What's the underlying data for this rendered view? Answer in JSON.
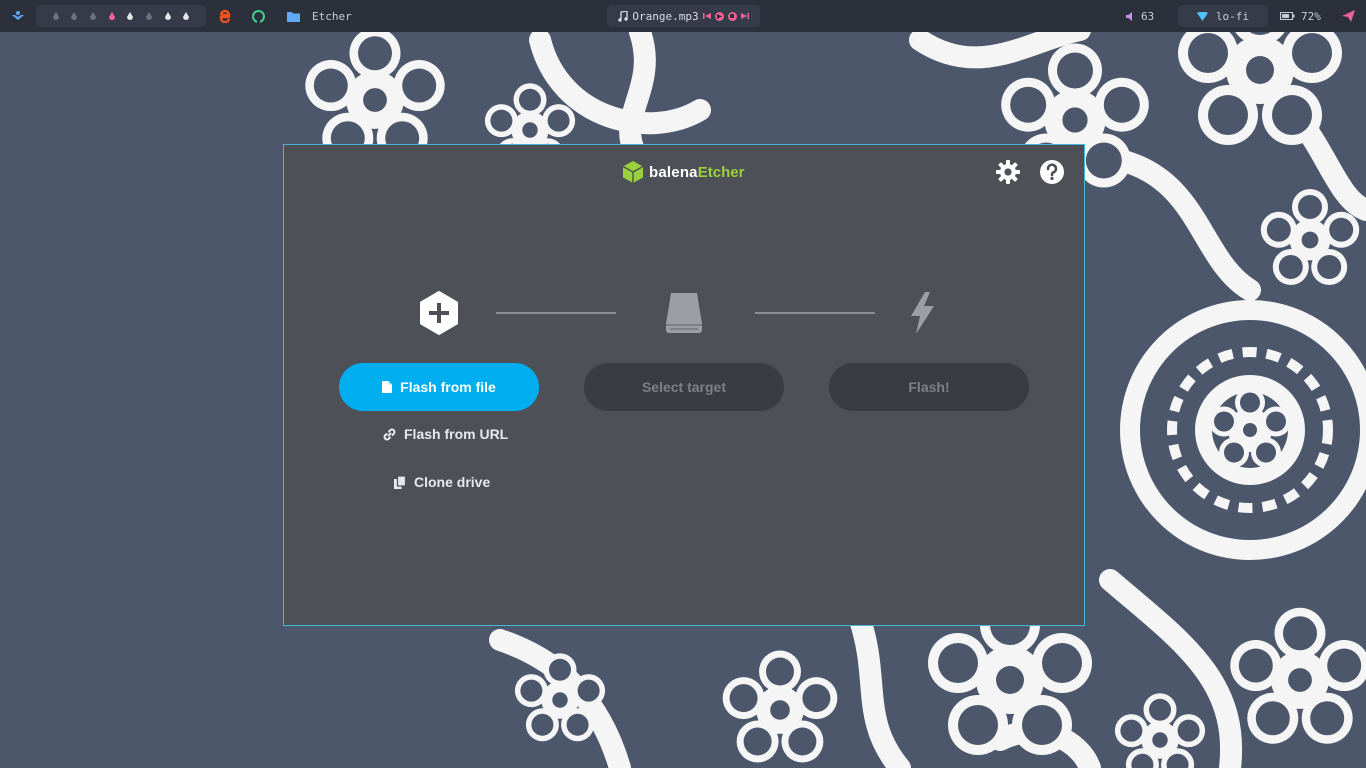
{
  "topbar": {
    "active_window_title": "Etcher",
    "music": {
      "track": "Orange.mp3"
    },
    "volume": "63",
    "network": "lo-fi",
    "battery": "72%"
  },
  "colors": {
    "topbar_bg": "#2b303b",
    "desktop_bg": "#4c576b",
    "window_bg": "#4d5057",
    "window_border": "#45b6d9",
    "primary_button": "#00aeef",
    "disabled_button": "#3a3c41",
    "brand_green": "#9ad03c",
    "accent_pink": "#f06292"
  },
  "etcher": {
    "brand": {
      "part1": "balena",
      "part2": "Etcher"
    },
    "steps": [
      {
        "icon": "plus-hexagon-icon",
        "button_label": "Flash from file",
        "button_icon": "file-icon",
        "enabled": true
      },
      {
        "icon": "drive-icon",
        "button_label": "Select target",
        "enabled": false
      },
      {
        "icon": "flash-icon",
        "button_label": "Flash!",
        "enabled": false
      }
    ],
    "links": [
      {
        "label": "Flash from URL",
        "icon": "link-icon"
      },
      {
        "label": "Clone drive",
        "icon": "copy-icon"
      }
    ]
  }
}
